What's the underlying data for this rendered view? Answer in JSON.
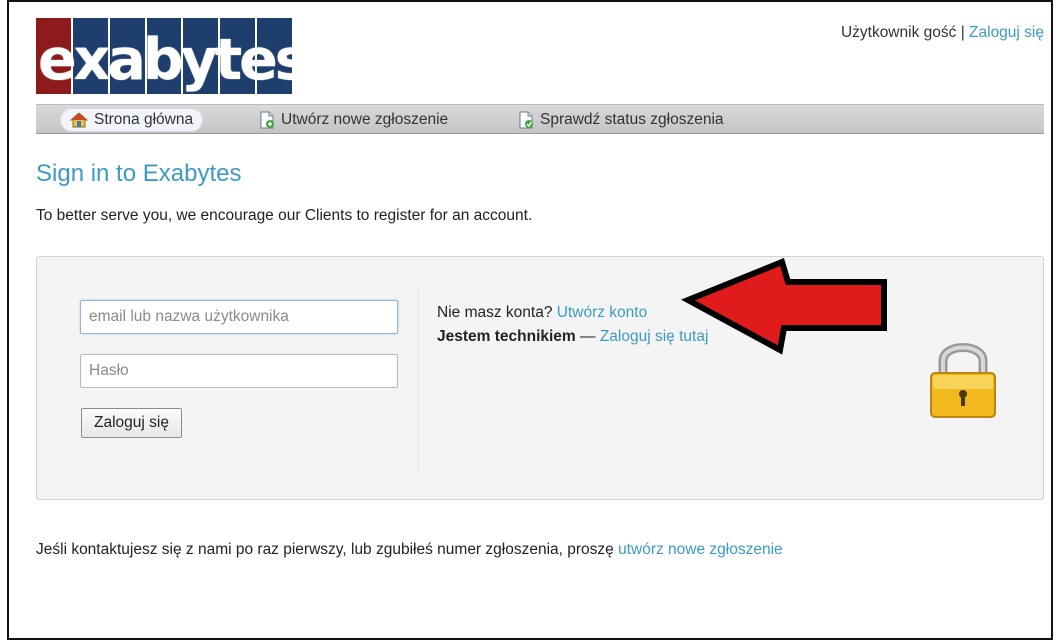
{
  "header": {
    "logo_text": "exabytes",
    "user_label": "Użytkownik gość",
    "separator": "|",
    "login_link": "Zaloguj się"
  },
  "nav": {
    "items": [
      {
        "label": "Strona główna",
        "icon": "home-icon"
      },
      {
        "label": "Utwórz nowe zgłoszenie",
        "icon": "new-ticket-icon"
      },
      {
        "label": "Sprawdź status zgłoszenia",
        "icon": "ticket-status-icon"
      }
    ]
  },
  "main": {
    "title": "Sign in to Exabytes",
    "intro": "To better serve you, we encourage our Clients to register for an account."
  },
  "login_form": {
    "email_placeholder": "email lub nazwa użytkownika",
    "password_placeholder": "Hasło",
    "submit_label": "Zaloguj się"
  },
  "signup": {
    "no_account_text": "Nie masz konta?",
    "create_account_link": "Utwórz konto",
    "agent_label": "Jestem technikiem",
    "dash": "—",
    "agent_login_link": "Zaloguj się tutaj"
  },
  "footer": {
    "text": "Jeśli kontaktujesz się z nami po raz pierwszy, lub zgubiłeś numer zgłoszenia, proszę",
    "link": "utwórz nowe zgłoszenie"
  },
  "colors": {
    "link": "#3d9ac5",
    "logo_blue": "#1e3f6e",
    "logo_red": "#8e1b1b",
    "arrow_red": "#e01b1b"
  }
}
